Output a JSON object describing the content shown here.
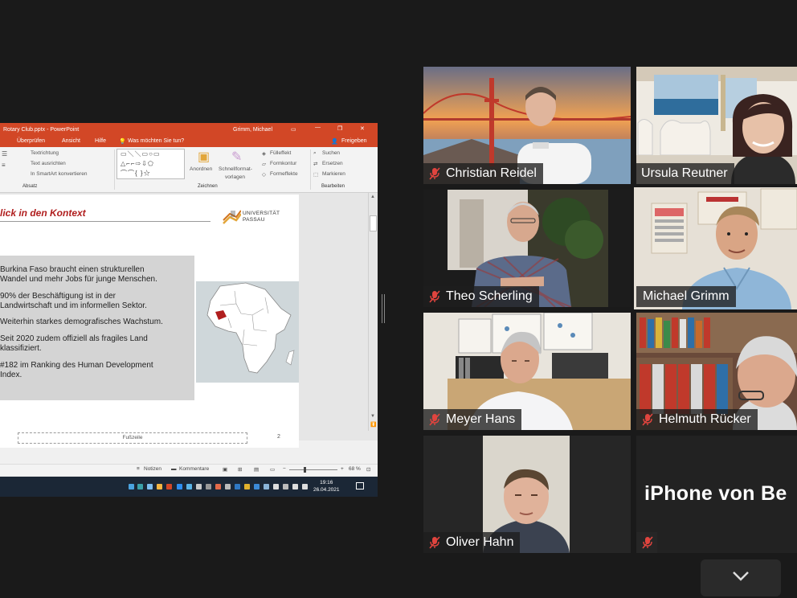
{
  "powerpoint": {
    "file_title": "Rotary Club.pptx - PowerPoint",
    "user": "Grimm, Michael",
    "tabs": [
      "Überprüfen",
      "Ansicht",
      "Hilfe"
    ],
    "tell_me": "Was möchten Sie tun?",
    "share": "Freigeben",
    "ribbon": {
      "textrichtung": "Textrichtung",
      "text_ausrichten": "Text ausrichten",
      "smartart": "In SmartArt konvertieren",
      "absatz": "Absatz",
      "anordnen": "Anordnen",
      "schnellformat": "Schnellformat-",
      "vorlagen": "vorlagen",
      "zeichnen": "Zeichnen",
      "fuelleffekt": "Fülleffekt",
      "formkontur": "Formkontur",
      "formeffekte": "Formeffekte",
      "suchen": "Suchen",
      "ersetzen": "Ersetzen",
      "markieren": "Markieren",
      "bearbeiten": "Bearbeiten"
    },
    "slide": {
      "title": "lick in den Kontext",
      "logo_line1": "UNIVERSITÄT",
      "logo_line2": "PASSAU",
      "bullets": [
        "Burkina Faso braucht einen strukturellen",
        "Wandel und mehr Jobs für junge Menschen.",
        "90% der Beschäftigung ist in der",
        "Landwirtschaft und im informellen Sektor.",
        "Weiterhin starkes demografisches Wachstum.",
        "Seit 2020 zudem offiziell als fragiles Land",
        "klassifiziert.",
        "#182 im Ranking des Human Development",
        "Index."
      ],
      "footer": "Fußzeile",
      "number": "2"
    },
    "statusbar": {
      "notes": "Notizen",
      "comments": "Kommentare",
      "zoom": "68 %"
    },
    "taskbar": {
      "time": "19:16",
      "date": "26.04.2021"
    }
  },
  "participants": [
    {
      "name": "Christian Reidel"
    },
    {
      "name": "Ursula Reutner"
    },
    {
      "name": "Theo Scherling"
    },
    {
      "name": "Michael Grimm"
    },
    {
      "name": "Meyer Hans"
    },
    {
      "name": "Helmuth Rücker"
    },
    {
      "name": "Oliver Hahn"
    },
    {
      "name": "iPhone von Be"
    }
  ],
  "colors": {
    "powerpoint_red": "#d24726",
    "active_speaker": "#c9e068",
    "mute_red": "#e0443e",
    "background": "#1a1a1a"
  }
}
